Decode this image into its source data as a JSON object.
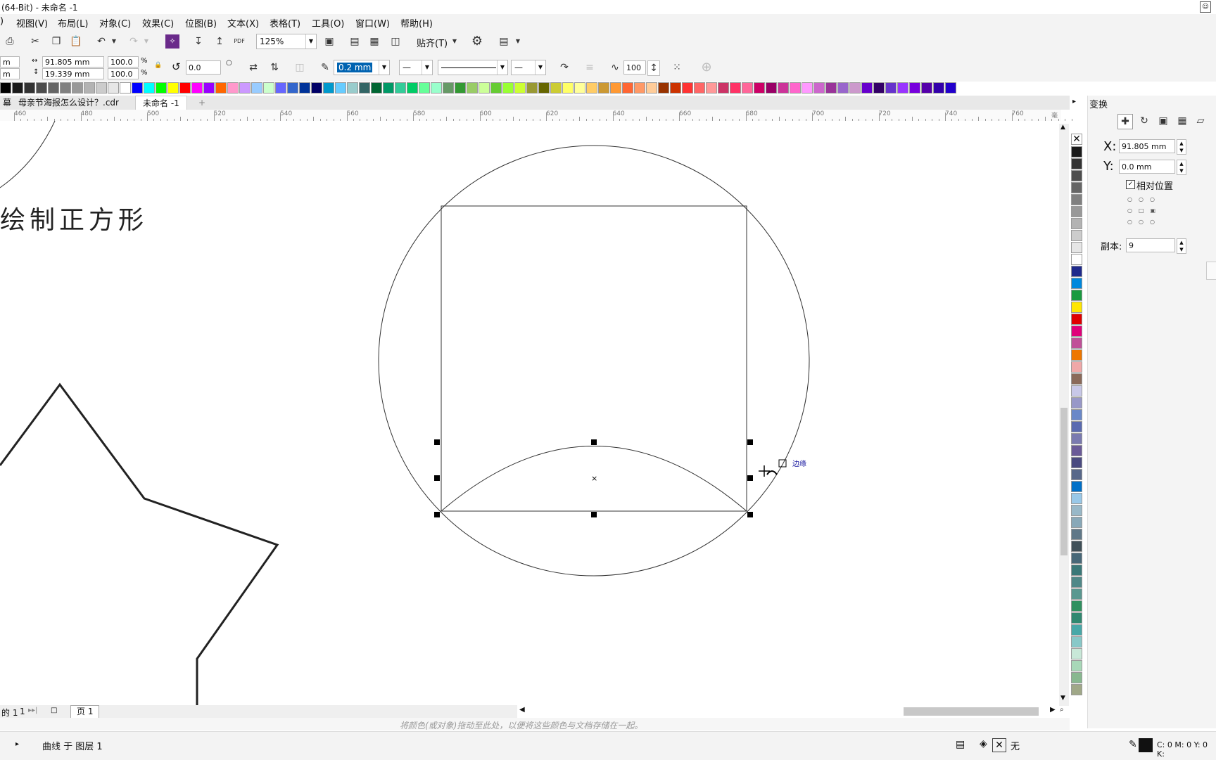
{
  "window": {
    "title": "(64-Bit) - 未命名 -1"
  },
  "menu": [
    "视图(V)",
    "布局(L)",
    "对象(C)",
    "效果(C)",
    "位图(B)",
    "文本(X)",
    "表格(T)",
    "工具(O)",
    "窗口(W)",
    "帮助(H)"
  ],
  "toolbar": {
    "zoom": "125%",
    "snap_label": "贴齐(T)"
  },
  "property_bar": {
    "x_unit": "m",
    "y_unit": "m",
    "width": "91.805 mm",
    "height": "19.339 mm",
    "scale_w": "100.0",
    "scale_h": "100.0",
    "percent_1": "%",
    "percent_2": "%",
    "rotation": "0.0",
    "outline_width": "0.2 mm",
    "smooth": "100"
  },
  "tabs": [
    {
      "label": "母亲节海报怎么设计？.cdr"
    },
    {
      "label": "未命名 -1"
    }
  ],
  "ruler": {
    "labels": [
      "460",
      "480",
      "500",
      "520",
      "540",
      "560",
      "580",
      "600",
      "620",
      "640",
      "660",
      "680",
      "700",
      "720",
      "740",
      "760"
    ],
    "unit": "毫米"
  },
  "canvas": {
    "heading": "绘制正方形",
    "cursor_label": "边缘"
  },
  "docker": {
    "title": "变换",
    "x_label": "X:",
    "x_value": "91.805 mm",
    "y_label": "Y:",
    "y_value": "0.0 mm",
    "relative_position": "相对位置",
    "copies_label": "副本:",
    "copies_value": "9"
  },
  "pages": {
    "counter": "的 1",
    "of": "1",
    "page_tab": "页 1"
  },
  "hint": "将颜色(或对象)拖动至此处，以便将这些颜色与文档存储在一起。",
  "status": {
    "object_info": "曲线 于 图层 1",
    "fill_none": "无",
    "color_info": "C: 0 M: 0 Y: 0 K:"
  },
  "colors": {
    "palette": [
      "#000000",
      "#1a1a1a",
      "#333333",
      "#4d4d4d",
      "#666666",
      "#808080",
      "#999999",
      "#b3b3b3",
      "#cccccc",
      "#e6e6e6",
      "#ffffff",
      "#0000ff",
      "#00ffff",
      "#00ff00",
      "#ffff00",
      "#ff0000",
      "#ff00ff",
      "#9900ff",
      "#ff6600",
      "#ff99cc",
      "#cc99ff",
      "#99ccff",
      "#ccffcc",
      "#6666ff",
      "#3366cc",
      "#003399",
      "#000066",
      "#0099cc",
      "#66ccff",
      "#99cccc",
      "#336666",
      "#006633",
      "#009966",
      "#33cc99",
      "#00cc66",
      "#66ff99",
      "#99ffcc",
      "#669966",
      "#339933",
      "#99cc66",
      "#ccff99",
      "#66cc33",
      "#99ff33",
      "#ccff33",
      "#999933",
      "#666600",
      "#cccc33",
      "#ffff66",
      "#ffff99",
      "#ffcc66",
      "#cc9933",
      "#ff9933",
      "#ff6633",
      "#ff9966",
      "#ffcc99",
      "#993300",
      "#cc3300",
      "#ff3333",
      "#ff6666",
      "#ff9999",
      "#cc3366",
      "#ff3366",
      "#ff6699",
      "#cc0066",
      "#990066",
      "#cc3399",
      "#ff66cc",
      "#ff99ff",
      "#cc66cc",
      "#993399",
      "#9966cc",
      "#cc99cc",
      "#6600cc",
      "#330066",
      "#6633cc",
      "#9933ff",
      "#7700dd",
      "#5500aa",
      "#3300aa",
      "#2200cc"
    ],
    "vpalette": [
      "#1a1a1a",
      "#333333",
      "#4d4d4d",
      "#666666",
      "#808080",
      "#999999",
      "#b3b3b3",
      "#cccccc",
      "#e6e6e6",
      "#ffffff",
      "#1f2a8c",
      "#0088dd",
      "#1a9a40",
      "#ffe600",
      "#e00000",
      "#e0007a",
      "#c05098",
      "#ee7700",
      "#f0a8a8",
      "#8a6a5a",
      "#c8c8e8",
      "#9898c8",
      "#6a88c8",
      "#5a6ab0",
      "#7a7ab0",
      "#6a5a98",
      "#4a4a80",
      "#58688a",
      "#0070c8",
      "#98c8e8",
      "#98b8c8",
      "#88a8b8",
      "#607888",
      "#405058",
      "#486878",
      "#3a7878",
      "#508888",
      "#5a9890",
      "#309060",
      "#308870",
      "#48a8a8",
      "#88c8c8",
      "#c8e8d8",
      "#a8d8b8",
      "#88b890",
      "#a0a888"
    ],
    "accent": "#0063b1"
  }
}
